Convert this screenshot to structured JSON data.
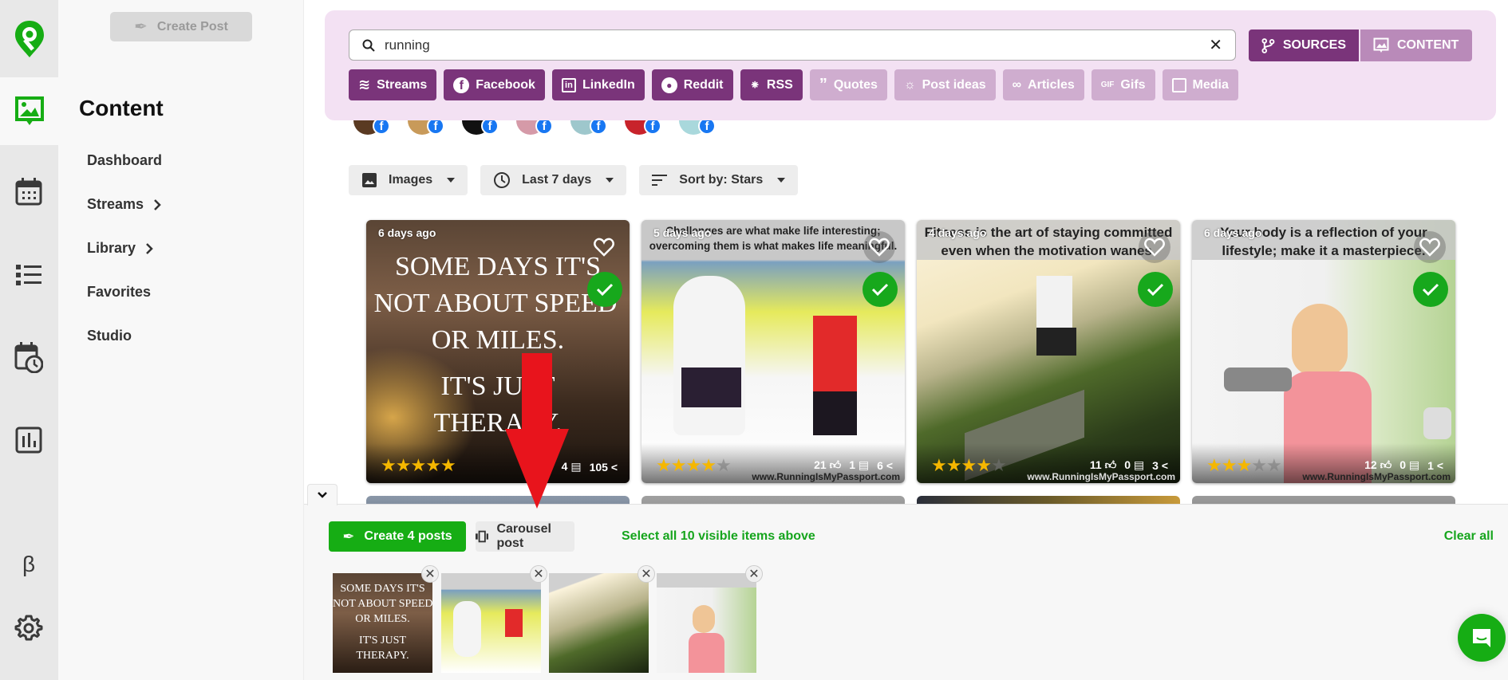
{
  "left_rail": {
    "items": [
      {
        "name": "logo",
        "icon": "location-pin-logo"
      },
      {
        "name": "content",
        "icon": "content-image-icon",
        "active": true
      },
      {
        "name": "calendar",
        "icon": "calendar-icon"
      },
      {
        "name": "list",
        "icon": "list-icon"
      },
      {
        "name": "schedule",
        "icon": "calendar-clock-icon"
      },
      {
        "name": "analytics",
        "icon": "bar-chart-icon"
      },
      {
        "name": "beta",
        "icon": "beta-icon",
        "label": "β"
      },
      {
        "name": "settings",
        "icon": "gear-icon"
      }
    ]
  },
  "sidebar": {
    "create_post_label": "Create Post",
    "title": "Content",
    "items": [
      {
        "label": "Dashboard",
        "has_chevron": false
      },
      {
        "label": "Streams",
        "has_chevron": true
      },
      {
        "label": "Library",
        "has_chevron": true
      },
      {
        "label": "Favorites",
        "has_chevron": false
      },
      {
        "label": "Studio",
        "has_chevron": false
      }
    ]
  },
  "search": {
    "value": "running",
    "clear_label": "✕"
  },
  "mode_toggle": {
    "sources_label": "SOURCES",
    "content_label": "CONTENT",
    "active": "SOURCES"
  },
  "source_chips": [
    {
      "label": "Streams",
      "icon": "streams-icon",
      "enabled": true
    },
    {
      "label": "Facebook",
      "icon": "facebook-icon",
      "enabled": true
    },
    {
      "label": "LinkedIn",
      "icon": "linkedin-icon",
      "enabled": true
    },
    {
      "label": "Reddit",
      "icon": "reddit-icon",
      "enabled": true
    },
    {
      "label": "RSS",
      "icon": "rss-icon",
      "enabled": true
    },
    {
      "label": "Quotes",
      "icon": "quote-icon",
      "enabled": false
    },
    {
      "label": "Post ideas",
      "icon": "lightbulb-icon",
      "enabled": false
    },
    {
      "label": "Articles",
      "icon": "link-icon",
      "enabled": false
    },
    {
      "label": "Gifs",
      "icon": "gif-icon",
      "enabled": false
    },
    {
      "label": "Media",
      "icon": "media-icon",
      "enabled": false
    }
  ],
  "source_avatars": [
    {
      "color": "#5a3a22"
    },
    {
      "color": "#c89a5a"
    },
    {
      "color": "#111111"
    },
    {
      "color": "#d59aa8"
    },
    {
      "color": "#9ec7cc"
    },
    {
      "color": "#c8232b"
    },
    {
      "color": "#a9d8dc"
    }
  ],
  "filters": {
    "type_label": "Images",
    "date_label": "Last 7 days",
    "sort_label": "Sort by: Stars"
  },
  "cards": [
    {
      "age": "6 days ago",
      "quote": "",
      "image_text": [
        "SOME DAYS IT'S",
        "NOT ABOUT SPEED",
        "OR MILES.",
        "",
        "IT'S JUST",
        "THERAPY."
      ],
      "stars": 5,
      "likes": "",
      "comments": "4",
      "shares": "105",
      "watermark": "",
      "selected": true,
      "favorited": false
    },
    {
      "age": "5 days ago",
      "quote": "Challenges are what make life interesting; overcoming them is what makes life meaningful.",
      "stars": 4,
      "likes": "21",
      "comments": "1",
      "shares": "6",
      "watermark": "www.RunningIsMyPassport.com",
      "selected": true,
      "favorited": false
    },
    {
      "age": "4 days ago",
      "quote": "Fitness is the art of staying committed even when the motivation wanes.",
      "stars": 4,
      "likes": "11",
      "comments": "0",
      "shares": "3",
      "watermark": "www.RunningIsMyPassport.com",
      "selected": true,
      "favorited": false
    },
    {
      "age": "6 days ago",
      "quote": "Your body is a reflection of your lifestyle; make it a masterpiece.",
      "stars": 3,
      "likes": "12",
      "comments": "0",
      "shares": "1",
      "watermark": "www.RunningIsMyPassport.com",
      "selected": true,
      "favorited": false
    }
  ],
  "bulk_bar": {
    "create_label": "Create 4 posts",
    "carousel_label": "Carousel post",
    "select_all_label": "Select all 10 visible items above",
    "clear_all_label": "Clear all",
    "selected_thumbnails": [
      {
        "caption": "SOME DAYS IT'S NOT ABOUT SPEED OR MILES. IT'S JUST THERAPY."
      },
      {
        "caption": "Challenges are what make life interesting; overcoming them is what makes life meaningful."
      },
      {
        "caption": "Fitness is the art of staying committed even when the motivation wanes."
      },
      {
        "caption": "Your body is a reflection of your lifestyle; make it a masterpiece."
      }
    ]
  },
  "colors": {
    "brand_green": "#16ad14",
    "purple_active": "#7a347a",
    "purple_inactive": "#cfadcf",
    "panel_bg": "#f3e1f3",
    "star": "#f5b700",
    "annotation_arrow": "#e8141c"
  }
}
